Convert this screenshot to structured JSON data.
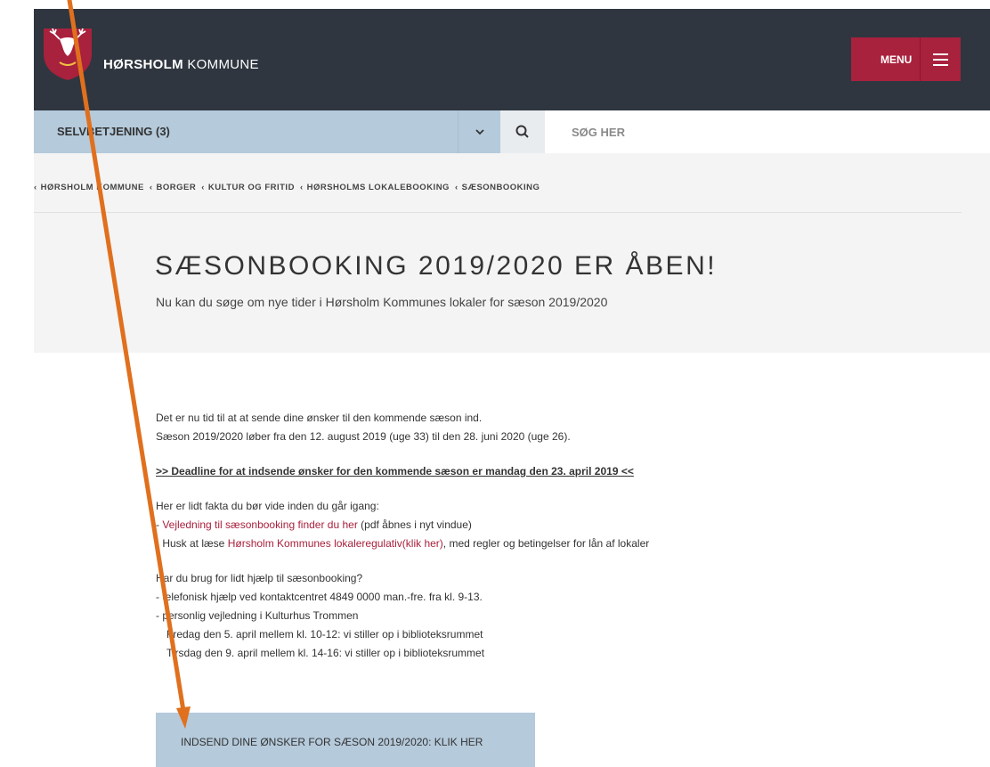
{
  "header": {
    "brand_bold": "HØRSHOLM",
    "brand_rest": " KOMMUNE",
    "menu_label": "MENU"
  },
  "searchbar": {
    "selfservice_label": "SELVBETJENING (3)",
    "search_placeholder": "SØG HER"
  },
  "breadcrumb": [
    "HØRSHOLM KOMMUNE",
    "BORGER",
    "KULTUR OG FRITID",
    "HØRSHOLMS LOKALEBOOKING",
    "SÆSONBOOKING"
  ],
  "page": {
    "title": "SÆSONBOOKING 2019/2020 ER ÅBEN!",
    "subtitle": "Nu kan du søge om nye tider i Hørsholm Kommunes lokaler for sæson 2019/2020"
  },
  "content": {
    "p1_line1": "Det er nu tid til at at sende dine ønsker til den kommende sæson ind.",
    "p1_line2": "Sæson 2019/2020 løber fra den 12. august 2019 (uge 33) til den 28. juni 2020 (uge 26).",
    "deadline": ">> Deadline for at indsende ønsker for den kommende sæson er mandag den 23. april 2019 <<",
    "facts_intro": "Her er lidt fakta du bør vide inden du går igang:",
    "fact1_prefix": "- ",
    "fact1_link": "Vejledning til sæsonbooking finder du her",
    "fact1_suffix": " (pdf åbnes i nyt vindue)",
    "fact2_prefix": "- Husk at læse ",
    "fact2_link": "Hørsholm Kommunes lokaleregulativ(klik her)",
    "fact2_suffix": ", med regler og betingelser for lån af lokaler",
    "help_intro": "Har du brug for lidt hjælp til sæsonbooking?",
    "help1": "- telefonisk hjælp ved kontaktcentret 4849 0000 man.-fre. fra kl. 9-13.",
    "help2": "- personlig vejledning i Kulturhus Trommen",
    "help3": "Fredag den 5. april mellem kl. 10-12: vi stiller op i biblioteksrummet",
    "help4": "Tirsdag den 9. april mellem kl. 14-16: vi stiller op i biblioteksrummet"
  },
  "cta": {
    "label": "INDSEND DINE ØNSKER FOR SÆSON 2019/2020: KLIK HER"
  },
  "colors": {
    "header_bg": "#2f3640",
    "accent": "#a8213d",
    "bar_blue": "#b5cadb",
    "hero_bg": "#f4f4f4",
    "arrow": "#e0701e"
  },
  "icons": {
    "logo": "deer-shield-icon",
    "menu": "hamburger-icon",
    "dropdown": "chevron-down-icon",
    "search": "search-icon"
  }
}
